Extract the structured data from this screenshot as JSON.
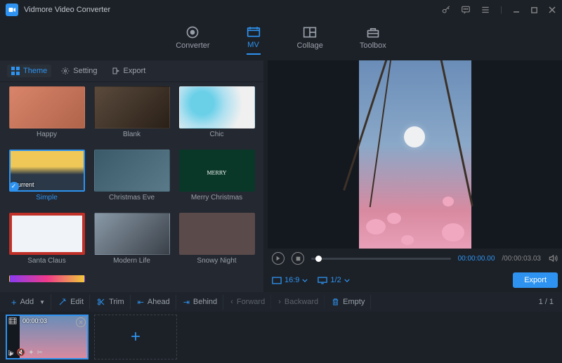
{
  "app": {
    "title": "Vidmore Video Converter"
  },
  "nav": {
    "converter": "Converter",
    "mv": "MV",
    "collage": "Collage",
    "toolbox": "Toolbox"
  },
  "subtabs": {
    "theme": "Theme",
    "setting": "Setting",
    "export": "Export"
  },
  "themes": {
    "happy": "Happy",
    "blank": "Blank",
    "chic": "Chic",
    "simple_overlay": "Current",
    "simple": "Simple",
    "christmas_eve": "Christmas Eve",
    "merry_christmas": "Merry Christmas",
    "santa_claus": "Santa Claus",
    "modern_life": "Modern Life",
    "snowy_night": "Snowy Night",
    "merry_overlay": "MERRY"
  },
  "player": {
    "time_current": "00:00:00.00",
    "time_total": "/00:00:03.03",
    "aspect": "16:9",
    "zoom": "1/2"
  },
  "export_btn": "Export",
  "toolbar": {
    "add": "Add",
    "edit": "Edit",
    "trim": "Trim",
    "ahead": "Ahead",
    "behind": "Behind",
    "forward": "Forward",
    "backward": "Backward",
    "empty": "Empty"
  },
  "pager": "1 / 1",
  "clip": {
    "duration": "00:00:03"
  }
}
